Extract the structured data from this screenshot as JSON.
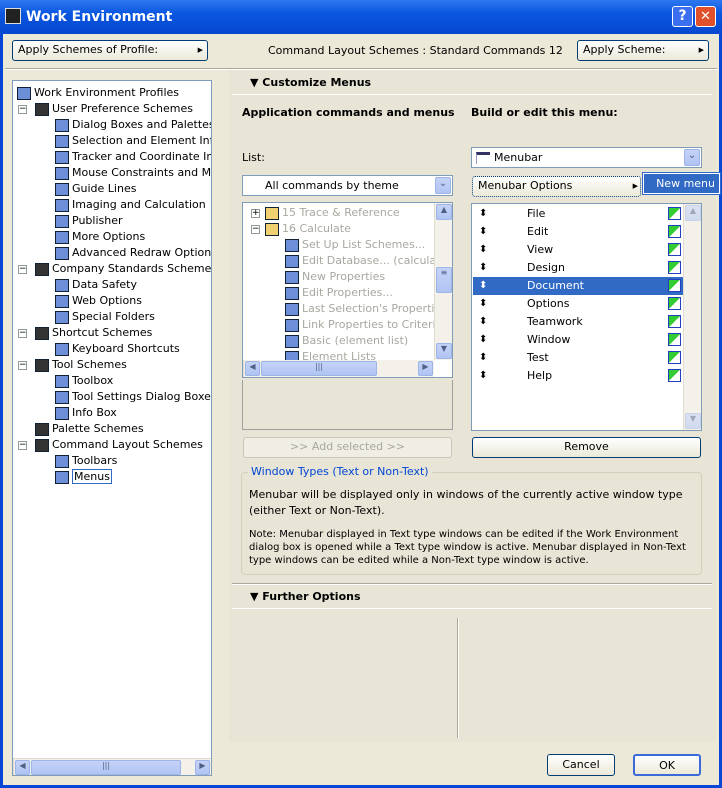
{
  "window": {
    "title": "Work Environment",
    "help": "?",
    "close": "✕"
  },
  "top": {
    "apply_profile": "Apply Schemes of Profile:",
    "scheme_label": "Command Layout Schemes : Standard Commands 12",
    "apply_scheme": "Apply Scheme:"
  },
  "tree": [
    {
      "label": "Work Environment Profiles",
      "level": 0
    },
    {
      "label": "User Preference Schemes",
      "level": 1,
      "toggle": "−"
    },
    {
      "label": "Dialog Boxes and Palettes",
      "level": 2
    },
    {
      "label": "Selection and Element Inform",
      "level": 2
    },
    {
      "label": "Tracker and Coordinate Input",
      "level": 2
    },
    {
      "label": "Mouse Constraints and Meth",
      "level": 2
    },
    {
      "label": "Guide Lines",
      "level": 2
    },
    {
      "label": "Imaging and Calculation",
      "level": 2
    },
    {
      "label": "Publisher",
      "level": 2
    },
    {
      "label": "More Options",
      "level": 2
    },
    {
      "label": "Advanced Redraw Options",
      "level": 2
    },
    {
      "label": "Company Standards Schemes",
      "level": 1,
      "toggle": "−"
    },
    {
      "label": "Data Safety",
      "level": 2
    },
    {
      "label": "Web Options",
      "level": 2
    },
    {
      "label": "Special Folders",
      "level": 2
    },
    {
      "label": "Shortcut Schemes",
      "level": 1,
      "toggle": "−"
    },
    {
      "label": "Keyboard Shortcuts",
      "level": 2
    },
    {
      "label": "Tool Schemes",
      "level": 1,
      "toggle": "−"
    },
    {
      "label": "Toolbox",
      "level": 2
    },
    {
      "label": "Tool Settings Dialog Boxes",
      "level": 2
    },
    {
      "label": "Info Box",
      "level": 2
    },
    {
      "label": "Palette Schemes",
      "level": 1
    },
    {
      "label": "Command Layout Schemes",
      "level": 1,
      "toggle": "−"
    },
    {
      "label": "Toolbars",
      "level": 2
    },
    {
      "label": "Menus",
      "level": 2,
      "selected": true
    }
  ],
  "customize": {
    "header": "Customize Menus",
    "left_title": "Application commands and menus",
    "right_title": "Build or edit this menu:",
    "list_label": "List:",
    "list_filter": "All commands by theme",
    "commands": [
      {
        "label": "15 Trace & Reference",
        "level": 0,
        "toggle": "+"
      },
      {
        "label": "16 Calculate",
        "level": 0,
        "toggle": "−"
      },
      {
        "label": "Set Up List Schemes...",
        "level": 1
      },
      {
        "label": "Edit Database... (calculate)",
        "level": 1
      },
      {
        "label": "New Properties",
        "level": 1
      },
      {
        "label": "Edit Properties...",
        "level": 1
      },
      {
        "label": "Last Selection's Properties...",
        "level": 1
      },
      {
        "label": "Link Properties to Criteria...",
        "level": 1
      },
      {
        "label": "Basic (element list)",
        "level": 1
      },
      {
        "label": "Element Lists",
        "level": 1
      }
    ],
    "add_selected": ">> Add selected >>",
    "menu_select": "Menubar",
    "menubar_options": "Menubar Options",
    "new_menu": "New menu",
    "menus": [
      "File",
      "Edit",
      "View",
      "Design",
      "Document",
      "Options",
      "Teamwork",
      "Window",
      "Test",
      "Help"
    ],
    "selected_menu": "Document",
    "remove": "Remove",
    "group_title": "Window Types (Text or Non-Text)",
    "group_text1": "Menubar will be displayed only in windows of the currently active window type (either Text or Non-Text).",
    "group_text2": "Note: Menubar displayed in Text type windows can be edited if the Work Environment dialog box is opened while a Text type window is active. Menubar displayed in Non-Text type windows can be edited while a Non-Text type window is active."
  },
  "further": {
    "header": "Further Options"
  },
  "buttons": {
    "cancel": "Cancel",
    "ok": "OK"
  },
  "colors": {
    "title_bar": "#0a56e0",
    "selection": "#316ac5",
    "group_title": "#0046d5"
  }
}
